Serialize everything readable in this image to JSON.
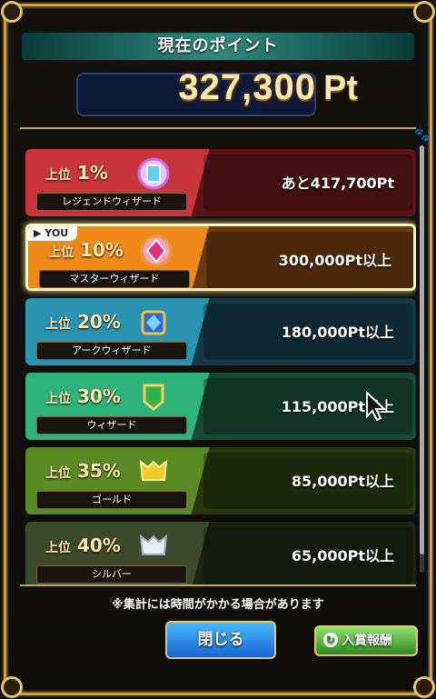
{
  "header": {
    "title": "現在のポイント"
  },
  "points": {
    "value": "327,300",
    "unit": "Pt"
  },
  "ranks": [
    {
      "tier_prefix": "上位",
      "tier_pct": "1%",
      "name": "レジェンドウィザード",
      "value": "あと417,700Pt",
      "color_left": "#c8353a",
      "color_panel": "#5b1516",
      "emblem": "legend-emblem-icon"
    },
    {
      "tier_prefix": "上位",
      "tier_pct": "10%",
      "name": "マスターウィザード",
      "value": "300,000Pt以上",
      "color_left": "#ef8a1a",
      "color_panel": "#6a3a0c",
      "emblem": "master-emblem-icon",
      "current": true
    },
    {
      "tier_prefix": "上位",
      "tier_pct": "20%",
      "name": "アークウィザード",
      "value": "180,000Pt以上",
      "color_left": "#2a93b0",
      "color_panel": "#163948",
      "emblem": "arc-emblem-icon"
    },
    {
      "tier_prefix": "上位",
      "tier_pct": "30%",
      "name": "ウィザード",
      "value": "115,000Pt以上",
      "color_left": "#2db37a",
      "color_panel": "#184836",
      "emblem": "wizard-emblem-icon"
    },
    {
      "tier_prefix": "上位",
      "tier_pct": "35%",
      "name": "ゴールド",
      "value": "85,000Pt以上",
      "color_left": "#5a8a24",
      "color_panel": "#26380f",
      "emblem": "gold-emblem-icon"
    },
    {
      "tier_prefix": "上位",
      "tier_pct": "40%",
      "name": "シルバー",
      "value": "65,000Pt以上",
      "color_left": "#3a4a2a",
      "color_panel": "#1c2414",
      "emblem": "silver-emblem-icon"
    }
  ],
  "you_label": "▶ YOU",
  "note": "※集計には時間がかかる場合があります",
  "buttons": {
    "close": "閉じる",
    "rewards": "入賞報酬"
  },
  "scroll_icon": "paw-icon"
}
